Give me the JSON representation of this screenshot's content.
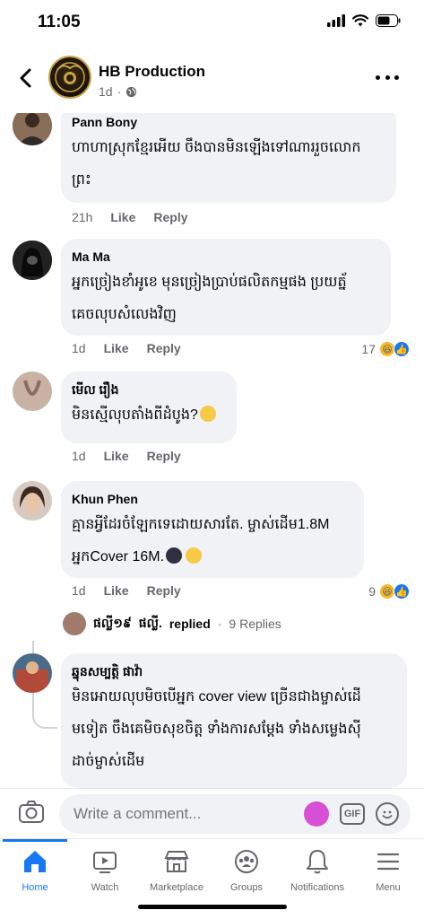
{
  "status_bar": {
    "time": "11:05"
  },
  "header": {
    "page_name": "HB Production",
    "time_ago": "1d"
  },
  "comments": [
    {
      "author": "Pann Bony",
      "lines": [
        "ហាហាស្រុកខ្មែរអើយ ចឹងបានមិនឡើងទៅណាររួចលោក",
        "ព្រះ"
      ],
      "time": "21h",
      "like": "Like",
      "reply": "Reply",
      "reaction_count": ""
    },
    {
      "author": "Ma Ma",
      "lines": [
        "អ្នកច្រៀងខាំអូខេ មុនច្រៀងប្រាប់ផលិតកម្មផង ប្រយត្ន័",
        "គេចលុបសំលេងវិញ"
      ],
      "time": "1d",
      "like": "Like",
      "reply": "Reply",
      "reaction_count": "17"
    },
    {
      "author": "មើល រឿង",
      "lines": [
        "មិនស្មើលុបតាំងពីដំបូង?"
      ],
      "time": "1d",
      "like": "Like",
      "reply": "Reply",
      "reaction_count": ""
    },
    {
      "author": "Khun Phen",
      "lines": [
        "គ្មានអ្វីដែរចំឡែកទេដោយសារតែ. ម្ចាស់ដើម1.8M",
        "អ្នកCover 16M."
      ],
      "time": "1d",
      "like": "Like",
      "reply": "Reply",
      "reaction_count": "9"
    },
    {
      "author": "ឆ្នុនសម្បត្តិ ផាវ៉ា",
      "lines": [
        "មិនអោយលុបមិចបើអ្នក cover view ច្រើនជាងម្ចាស់ដើ",
        "មទៀត ចឹងគេមិចសុខចិត្ត ទាំងការសម្តែង ទាំងសម្លេងស៊ី",
        "ដាច់ម្ចាស់ដើម"
      ],
      "time": "",
      "like": "",
      "reply": "",
      "reaction_count": ""
    }
  ],
  "reply_thread": {
    "name": "ផល្លី១៩",
    "replied_by": "ផល្លី.",
    "action": "replied",
    "separator": "·",
    "count": "9 Replies"
  },
  "composer": {
    "placeholder": "Write a comment...",
    "gif": "GIF"
  },
  "tabs": [
    {
      "label": "Home",
      "icon": "home-icon",
      "active": true
    },
    {
      "label": "Watch",
      "icon": "watch-icon"
    },
    {
      "label": "Marketplace",
      "icon": "marketplace-icon"
    },
    {
      "label": "Groups",
      "icon": "groups-icon"
    },
    {
      "label": "Notifications",
      "icon": "bell-icon"
    },
    {
      "label": "Menu",
      "icon": "menu-icon"
    }
  ],
  "colors": {
    "accent": "#1877f2",
    "bubble": "#f0f2f5",
    "muted": "#65676b"
  }
}
